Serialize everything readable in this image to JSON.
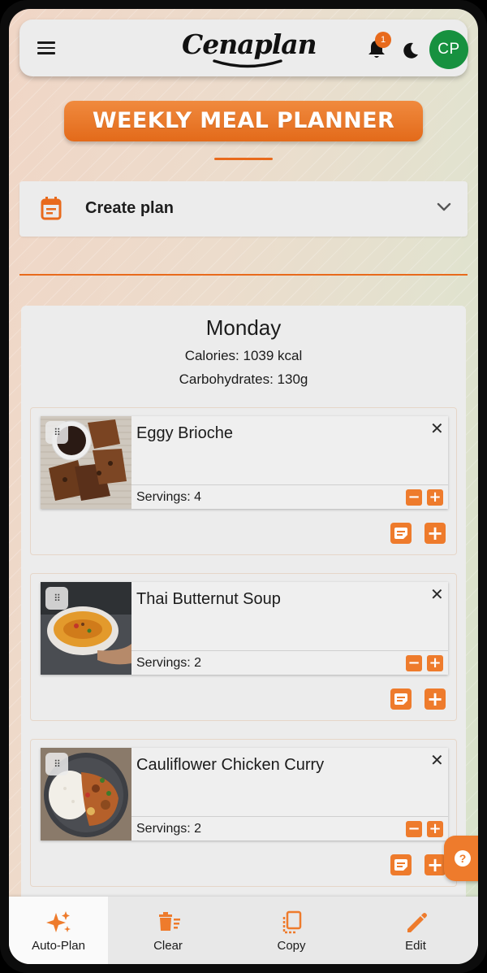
{
  "header": {
    "logo_text": "Cenaplan",
    "notification_count": "1",
    "avatar_initials": "CP"
  },
  "page_title": "WEEKLY MEAL PLANNER",
  "create_plan": {
    "label": "Create plan"
  },
  "day": {
    "name": "Monday",
    "calories": "Calories: 1039 kcal",
    "carbohydrates": "Carbohydrates: 130g",
    "meals": [
      {
        "name": "Eggy Brioche",
        "servings": "Servings: 4"
      },
      {
        "name": "Thai Butternut Soup",
        "servings": "Servings: 2"
      },
      {
        "name": "Cauliflower Chicken Curry",
        "servings": "Servings: 2"
      }
    ]
  },
  "bottom_nav": {
    "auto_plan": "Auto-Plan",
    "clear": "Clear",
    "copy": "Copy",
    "edit": "Edit"
  },
  "colors": {
    "accent": "#ee7b2c",
    "avatar": "#17913f"
  },
  "icons": [
    "menu-icon",
    "bell-icon",
    "moon-icon",
    "calendar-icon",
    "chevron-down-icon",
    "drag-handle-icon",
    "close-icon",
    "minus-icon",
    "plus-icon",
    "note-icon",
    "help-icon",
    "sparkles-icon",
    "trash-icon",
    "copy-icon",
    "pencil-icon"
  ]
}
